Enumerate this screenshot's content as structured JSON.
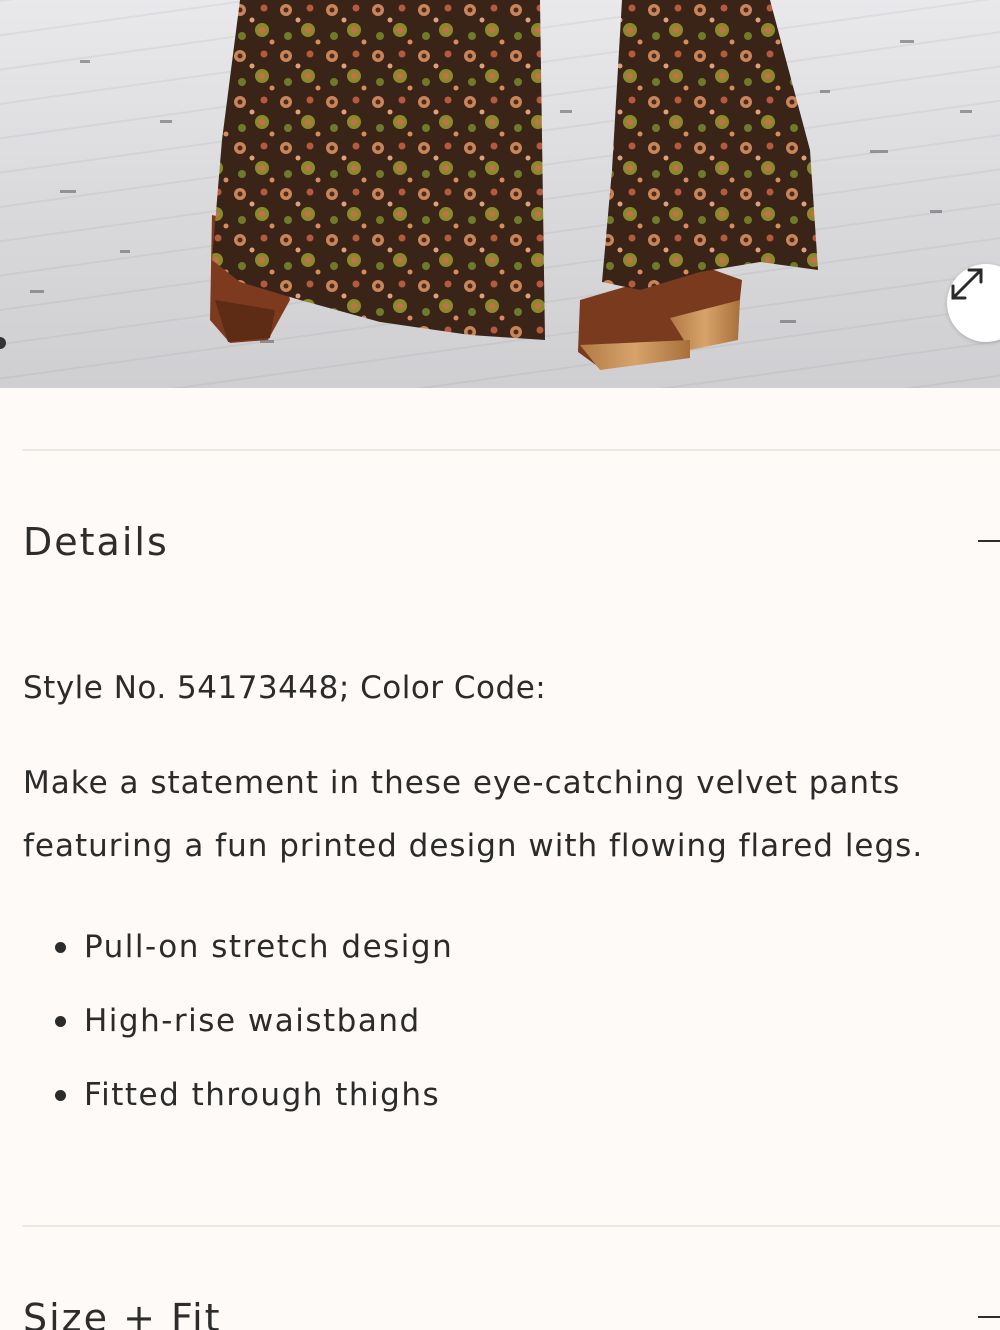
{
  "product_image": {
    "alt": "",
    "zoom_icon": "expand-arrows-icon"
  },
  "details": {
    "title": "Details",
    "toggle_icon": "minus-icon",
    "style_line": "Style No. 54173448; Color Code:",
    "description": "Make a statement in these eye-catching velvet pants featuring a fun printed design with flowing flared legs.",
    "features": [
      "Pull-on stretch design",
      "High-rise waistband",
      "Fitted through thighs"
    ]
  },
  "size_fit": {
    "title": "Size + Fit",
    "toggle_icon": "minus-icon"
  },
  "colors": {
    "background": "#fdfaf7",
    "text": "#2b2b2b",
    "divider": "#ece8e2"
  }
}
